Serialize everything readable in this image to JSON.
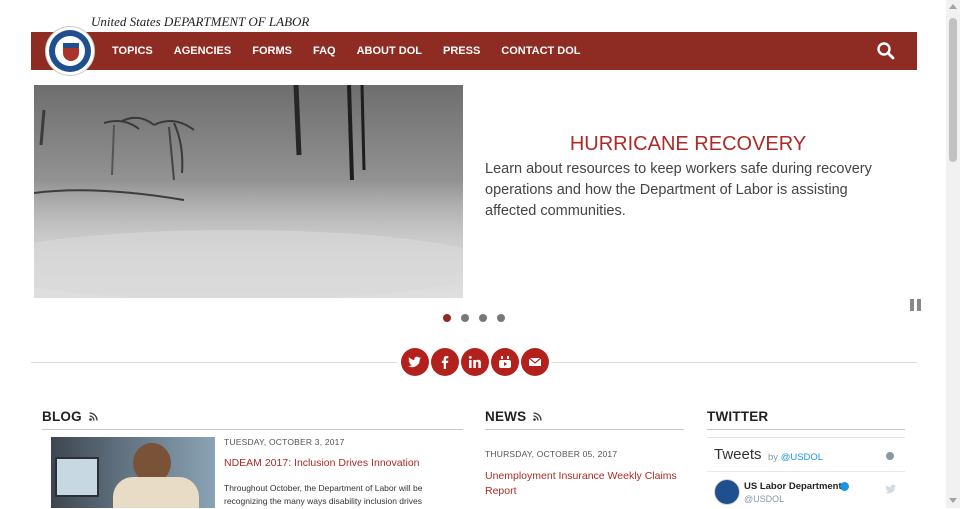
{
  "header": {
    "agency_line": "United States DEPARTMENT OF LABOR",
    "seal_icon": "dol-seal-icon",
    "brand_color": "#8e2b22"
  },
  "nav": {
    "items": [
      {
        "label": "TOPICS"
      },
      {
        "label": "AGENCIES"
      },
      {
        "label": "FORMS"
      },
      {
        "label": "FAQ"
      },
      {
        "label": "ABOUT DOL"
      },
      {
        "label": "PRESS"
      },
      {
        "label": "CONTACT DOL"
      }
    ],
    "search_icon": "search-icon"
  },
  "hero": {
    "title": "HURRICANE RECOVERY",
    "text": "Learn about resources to keep workers safe during recovery operations and how the Department of Labor is assisting affected communities.",
    "image": "hurricane-palm-trees-image",
    "slides": 4,
    "active_slide": 1,
    "pause_icon": "pause-icon",
    "accent_color": "#ab2b26"
  },
  "social": {
    "icons": [
      "twitter-icon",
      "facebook-icon",
      "linkedin-icon",
      "youtube-icon",
      "email-icon"
    ],
    "color": "#b3211d"
  },
  "blog": {
    "heading": "BLOG",
    "rss_icon": "rss-icon",
    "date": "TUESDAY, OCTOBER 3, 2017",
    "title": "NDEAM 2017: Inclusion Drives Innovation",
    "excerpt_line1": "Throughout October, the Department of Labor will be",
    "excerpt_line2": "recognizing the many ways disability inclusion drives"
  },
  "news": {
    "heading": "NEWS",
    "rss_icon": "rss-icon",
    "date": "THURSDAY, OCTOBER 05, 2017",
    "title": "Unemployment Insurance Weekly Claims Report"
  },
  "twitter": {
    "heading": "TWITTER",
    "widget_title": "Tweets",
    "by_text": "by ",
    "by_handle": "@USDOL",
    "account_name": "US Labor Department",
    "account_handle": "@USDOL",
    "info_icon": "info-icon",
    "verified_icon": "verified-icon",
    "bird_icon": "twitter-bird-icon"
  }
}
